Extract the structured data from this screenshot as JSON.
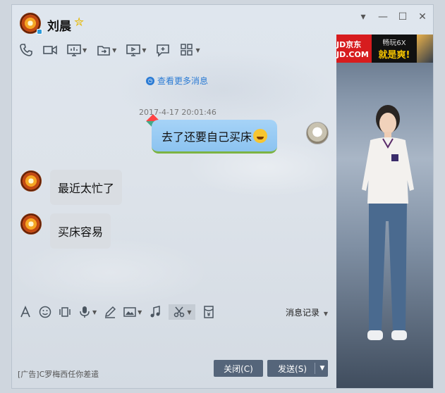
{
  "window": {
    "contact_name": "刘晨",
    "controls": [
      "▾",
      "—",
      "☐",
      "✕"
    ]
  },
  "toolbar": {
    "icons": [
      "phone-icon",
      "video-icon",
      "screen-share-icon",
      "transfer-icon",
      "remote-desktop-icon",
      "add-message-icon",
      "apps-icon"
    ]
  },
  "chat": {
    "more_messages": "查看更多消息",
    "timestamp": "2017-4-17 20:01:46",
    "messages": [
      {
        "from": "self",
        "text": "去了还要自己买床"
      },
      {
        "from": "contact",
        "text": "最近太忙了"
      },
      {
        "from": "contact",
        "text": "买床容易"
      }
    ]
  },
  "input_toolbar": {
    "history_label": "消息记录"
  },
  "ad": {
    "jd_text": "JD京东 JD.COM",
    "line1": "畅玩6X",
    "line2": "就是爽!"
  },
  "footer": {
    "ad_text": "[广告]C罗梅西任你差遣",
    "close_label": "关闭(C)",
    "send_label": "发送(S)"
  },
  "colors": {
    "accent_blue": "#2b7bd4",
    "button_bg": "#55657a",
    "bubble_out": "#a6d3f7",
    "bubble_in": "#d9dde2"
  }
}
